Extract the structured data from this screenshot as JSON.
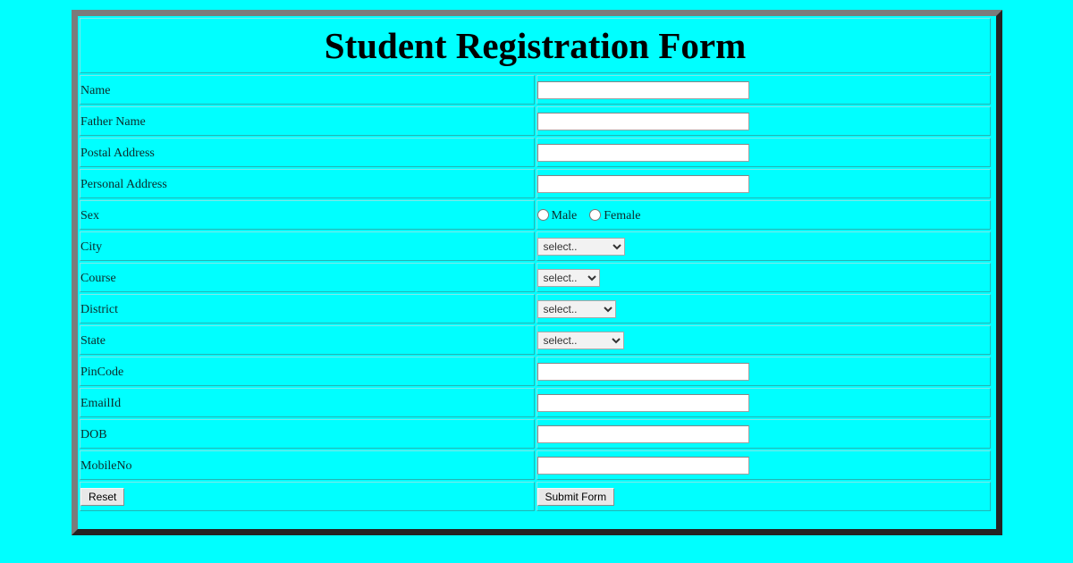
{
  "page": {
    "background_color": "#00ffff",
    "frame_border_light": "#7b7b7b",
    "frame_border_dark": "#242424"
  },
  "form": {
    "title": "Student Registration Form",
    "rows": [
      {
        "label": "Name",
        "control": "text"
      },
      {
        "label": "Father Name",
        "control": "text"
      },
      {
        "label": "Postal Address",
        "control": "text"
      },
      {
        "label": "Personal Address",
        "control": "text"
      },
      {
        "label": "Sex",
        "control": "radio"
      },
      {
        "label": "City",
        "control": "select"
      },
      {
        "label": "Course",
        "control": "select"
      },
      {
        "label": "District",
        "control": "select"
      },
      {
        "label": "State",
        "control": "select"
      },
      {
        "label": "PinCode",
        "control": "text"
      },
      {
        "label": "EmailId",
        "control": "text"
      },
      {
        "label": "DOB",
        "control": "text"
      },
      {
        "label": "MobileNo",
        "control": "text"
      }
    ],
    "labels": {
      "name": "Name",
      "father_name": "Father Name",
      "postal_address": "Postal Address",
      "personal_address": "Personal Address",
      "sex": "Sex",
      "city": "City",
      "course": "Course",
      "district": "District",
      "state": "State",
      "pincode": "PinCode",
      "emailid": "EmailId",
      "dob": "DOB",
      "mobileno": "MobileNo"
    },
    "values": {
      "name": "",
      "father_name": "",
      "postal_address": "",
      "personal_address": "",
      "pincode": "",
      "emailid": "",
      "dob": "",
      "mobileno": ""
    },
    "sex_options": [
      {
        "label": "Male",
        "checked": false
      },
      {
        "label": "Female",
        "checked": false
      }
    ],
    "selects": {
      "city": {
        "selected": "select.."
      },
      "course": {
        "selected": "select.."
      },
      "district": {
        "selected": "select.."
      },
      "state": {
        "selected": "select.."
      }
    },
    "buttons": {
      "reset": "Reset",
      "submit": "Submit Form"
    }
  }
}
